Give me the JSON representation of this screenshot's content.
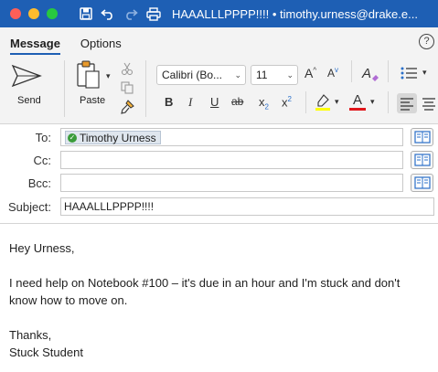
{
  "window": {
    "title": "HAAALLLPPPP!!!! • timothy.urness@drake.e..."
  },
  "ribbon_tabs": [
    {
      "label": "Message"
    },
    {
      "label": "Options"
    }
  ],
  "help_label": "?",
  "ribbon": {
    "send_label": "Send",
    "paste_label": "Paste",
    "font_name": "Calibri (Bo...",
    "font_size": "11",
    "bold": "B",
    "italic": "I",
    "underline": "U",
    "strikethrough": "ab",
    "subscript": "x",
    "superscript": "x",
    "font_color_letter": "A",
    "grow_font": "A",
    "shrink_font": "A",
    "clear_format": "A"
  },
  "header": {
    "to_label": "To:",
    "cc_label": "Cc:",
    "bcc_label": "Bcc:",
    "subject_label": "Subject:",
    "to_recipient": "Timothy Urness",
    "subject_value": "HAAALLLPPPP!!!!"
  },
  "message_body": {
    "greeting": "Hey Urness,",
    "line1": "I need help on Notebook #100 – it's due in an hour and I'm stuck and don't",
    "line2": "know how to move on.",
    "closing": "Thanks,",
    "signature": "Stuck Student"
  },
  "colors": {
    "titlebar": "#1e5fb4",
    "highlight_bar": "#ffff00",
    "font_color_bar": "#e0161b"
  }
}
